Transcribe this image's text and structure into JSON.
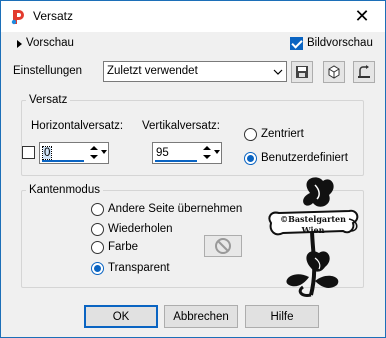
{
  "window": {
    "title": "Versatz",
    "close_glyph": "✕"
  },
  "header": {
    "preview_label": "Vorschau",
    "image_preview_label": "Bildvorschau",
    "image_preview_checked": true
  },
  "settings": {
    "label": "Einstellungen",
    "selected": "Zuletzt verwendet",
    "icons": [
      "save-icon",
      "reset-icon",
      "restore-icon"
    ]
  },
  "offset_group": {
    "label": "Versatz",
    "horizontal_label": "Horizontalversatz:",
    "horizontal_value": "0",
    "vertical_label": "Vertikalversatz:",
    "vertical_value": "95",
    "radio_centered": "Zentriert",
    "radio_custom": "Benutzerdefiniert",
    "selected_radio": "Benutzerdefiniert"
  },
  "edge_group": {
    "label": "Kantenmodus",
    "options": [
      "Andere Seite übernehmen",
      "Wiederholen",
      "Farbe",
      "Transparent"
    ],
    "selected": "Transparent"
  },
  "watermark": {
    "line1": "©Bastelgarten",
    "line2": "Wien"
  },
  "buttons": {
    "ok": "OK",
    "cancel": "Abbrechen",
    "help": "Hilfe"
  },
  "colors": {
    "accent": "#0a64c2",
    "window_bg": "#f0f0f0",
    "app_icon_red": "#e33b2e"
  }
}
